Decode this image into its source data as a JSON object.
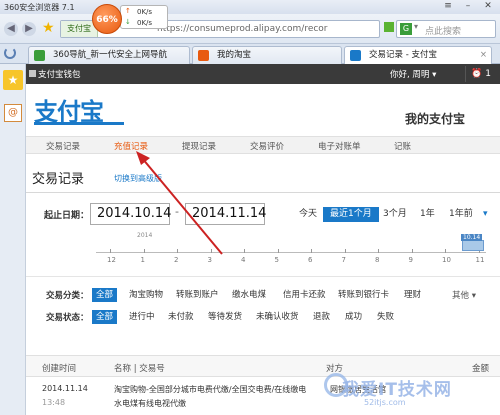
{
  "browser": {
    "title": "360安全浏览器 7.1",
    "speed_percent": "66%",
    "upload_speed": "0K/s",
    "download_speed": "0K/s",
    "site_badge": "支付宝",
    "url": "https://consumeprod.alipay.com/recor",
    "search_placeholder": "点此搜索",
    "tabs": [
      {
        "label": "360导航_新一代安全上网导航"
      },
      {
        "label": "我的淘宝"
      },
      {
        "label": "交易记录 - 支付宝"
      }
    ]
  },
  "alipay_bar": {
    "wallet": "支付宝钱包",
    "greeting": "你好,",
    "username": "周明",
    "alarm_count": "1"
  },
  "header": {
    "logo": "支付宝",
    "my_alipay": "我的支付宝"
  },
  "nav": [
    "交易记录",
    "充值记录",
    "提现记录",
    "交易评价",
    "电子对账单",
    "记账"
  ],
  "page": {
    "title": "交易记录",
    "switch_link": "切换到高级版"
  },
  "date_filter": {
    "label": "起止日期：",
    "start": "2014.10.14",
    "end": "2014.11.14",
    "ranges": [
      "今天",
      "最近1个月",
      "3个月",
      "1年",
      "1年前"
    ]
  },
  "timeline": {
    "year": "2014",
    "badge": "10.14",
    "labels": [
      "12",
      "1",
      "2",
      "3",
      "4",
      "5",
      "6",
      "7",
      "8",
      "9",
      "10",
      "11"
    ]
  },
  "filters": {
    "category_label": "交易分类：",
    "categories": [
      "全部",
      "淘宝购物",
      "转账到账户",
      "缴水电煤",
      "信用卡还款",
      "转账到银行卡",
      "理财"
    ],
    "more": "其他",
    "status_label": "交易状态：",
    "statuses": [
      "全部",
      "进行中",
      "未付款",
      "等待发货",
      "未确认收货",
      "退款",
      "成功",
      "失败"
    ]
  },
  "table": {
    "headers": [
      "创建时间",
      "名称 | 交易号",
      "对方",
      "金额"
    ],
    "rows": [
      {
        "date": "2014.11.14",
        "time": "13:48",
        "name": "淘宝购物-全国部分城市电费代缴/全国交电费/在线缴电",
        "name2": "水电煤有线电视代缴",
        "counterparty": "网银缴居生活馆"
      }
    ]
  },
  "watermark": {
    "text": "我爱IT技术网",
    "sub": "52itjs.com"
  },
  "colors": {
    "accent": "#1a79c8",
    "highlight": "#e85a10",
    "annotation": "#cc2222"
  }
}
